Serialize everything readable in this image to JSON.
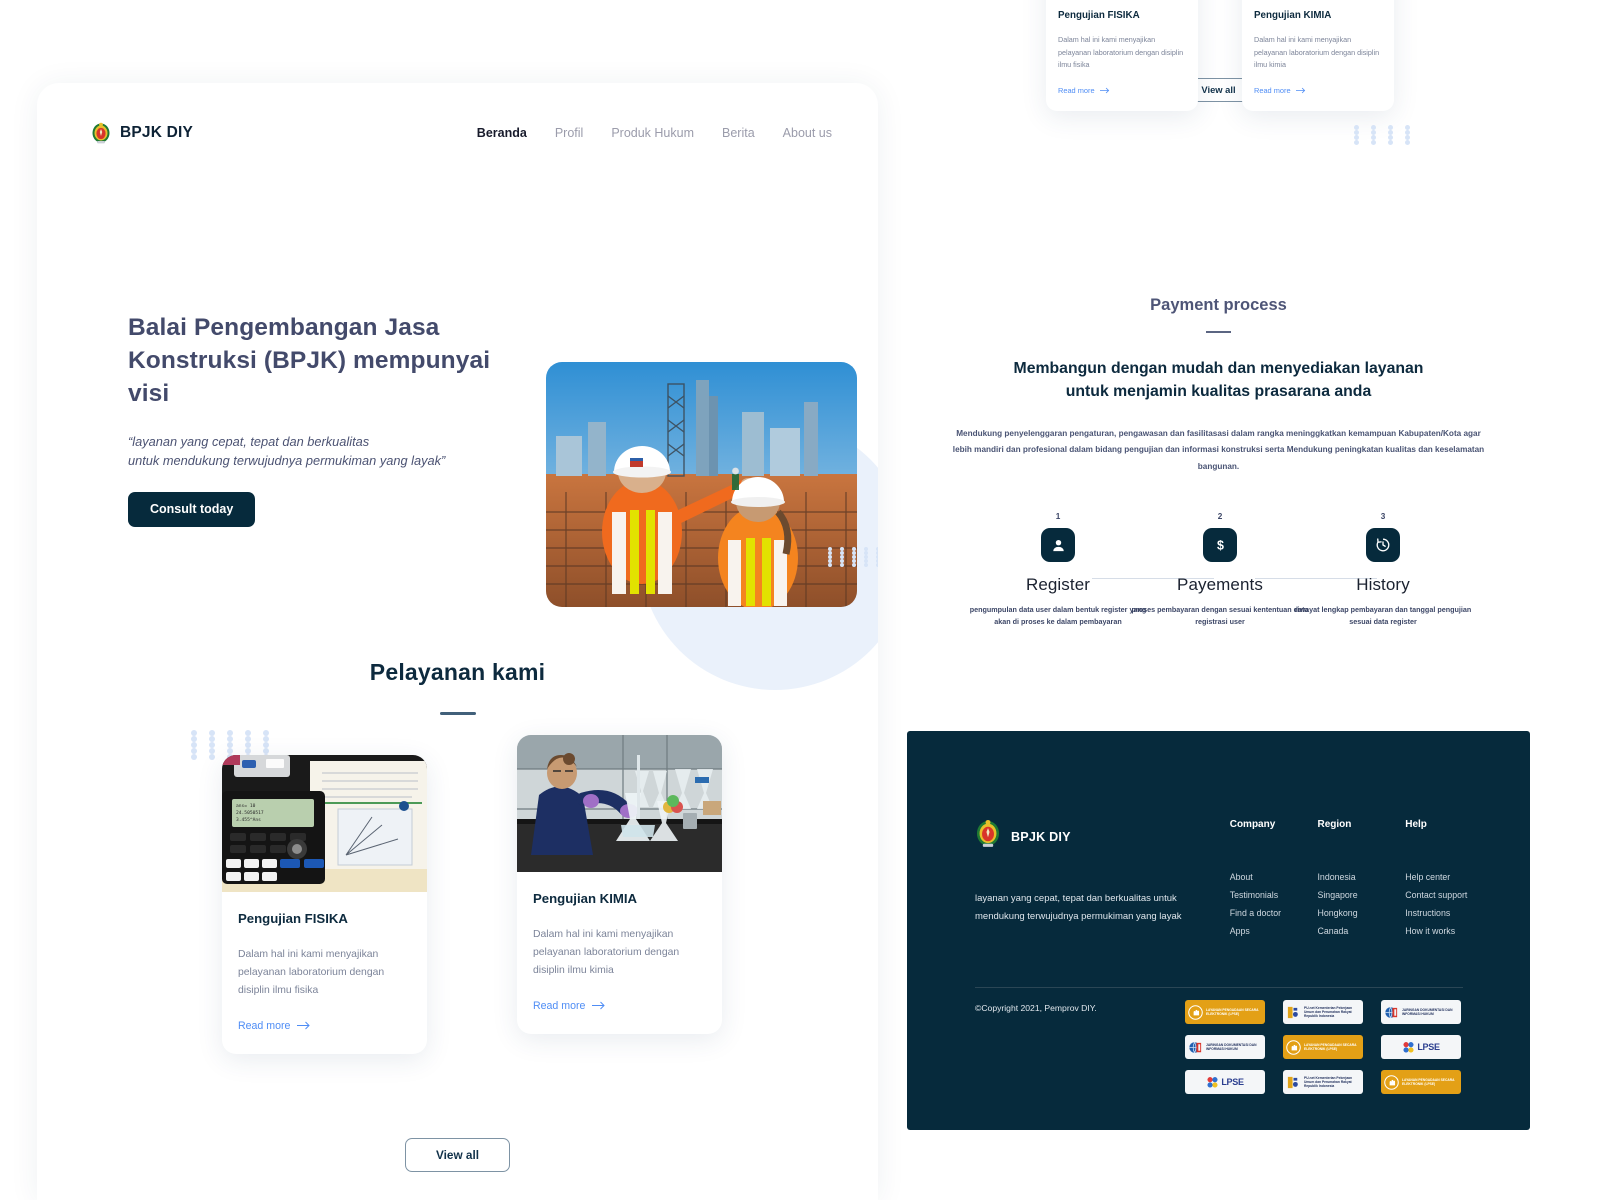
{
  "brand": {
    "name": "BPJK DIY",
    "logo_icon": "coat-of-arms-icon"
  },
  "nav": {
    "items": [
      {
        "label": "Beranda",
        "active": true
      },
      {
        "label": "Profil",
        "active": false
      },
      {
        "label": "Produk Hukum",
        "active": false
      },
      {
        "label": "Berita",
        "active": false
      },
      {
        "label": "About us",
        "active": false
      }
    ]
  },
  "hero": {
    "title": "Balai Pengembangan Jasa Konstruksi  (BPJK) mempunyai visi",
    "subtitle_line1": "“layanan yang cepat, tepat dan berkualitas",
    "subtitle_line2": "untuk mendukung terwujudnya permukiman yang layak”",
    "cta_label": "Consult today",
    "image_alt": "construction-workers-site-photo"
  },
  "services": {
    "title": "Pelayanan kami",
    "view_all_label": "View all",
    "read_more_label": "Read more",
    "cards": [
      {
        "title": "Pengujian FISIKA",
        "desc": "Dalam hal ini kami menyajikan pelayanan laboratorium dengan disiplin ilmu fisika",
        "link": "Read more",
        "image_alt": "calculator-and-notebook-photo"
      },
      {
        "title": "Pengujian KIMIA",
        "desc": "Dalam hal ini kami menyajikan pelayanan laboratorium dengan disiplin ilmu kimia",
        "link": "Read more",
        "image_alt": "chemistry-lab-technician-photo"
      }
    ]
  },
  "right_top": {
    "view_all_label": "View all",
    "cards": [
      {
        "title": "Pengujian FISIKA",
        "desc": "Dalam hal ini kami menyajikan pelayanan laboratorium dengan disiplin ilmu fisika",
        "link": "Read more"
      },
      {
        "title": "Pengujian KIMIA",
        "desc": "Dalam hal ini kami menyajikan pelayanan laboratorium dengan disiplin ilmu kimia",
        "link": "Read more"
      }
    ]
  },
  "payment": {
    "eyebrow": "Payment process",
    "heading_line1": "Membangun dengan mudah dan menyediakan layanan",
    "heading_line2": "untuk menjamin kualitas prasarana anda",
    "paragraph": "Mendukung penyelenggaran pengaturan, pengawasan dan fasilitasasi dalam rangka meninggkatkan kemampuan Kabupaten/Kota agar lebih mandiri dan profesional dalam bidang pengujian dan informasi konstruksi  serta Mendukung peningkatan kualitas dan keselamatan bangunan.",
    "steps": [
      {
        "number": "1",
        "icon": "user-icon",
        "name": "Register",
        "desc": "pengumpulan data user dalam bentuk register yang akan di proses ke dalam pembayaran"
      },
      {
        "number": "2",
        "icon": "dollar-icon",
        "name": "Payements",
        "desc": "proses pembayaran dengan sesuai kententuan data registrasi user"
      },
      {
        "number": "3",
        "icon": "history-clock-icon",
        "name": "History",
        "desc": "riwayat lengkap pembayaran dan tanggal pengujian sesuai data register"
      }
    ]
  },
  "footer": {
    "brand_name": "BPJK DIY",
    "tagline": "layanan yang cepat, tepat dan berkualitas untuk mendukung terwujudnya permukiman yang layak",
    "columns": [
      {
        "title": "Company",
        "links": [
          "About",
          "Testimonials",
          "Find a doctor",
          "Apps"
        ]
      },
      {
        "title": "Region",
        "links": [
          "Indonesia",
          "Singapore",
          "Hongkong",
          "Canada"
        ]
      },
      {
        "title": "Help",
        "links": [
          "Help center",
          "Contact support",
          "Instructions",
          "How it works"
        ]
      }
    ],
    "copyright": "©Copyright 2021, Pemprov DIY.",
    "badges": [
      {
        "kind": "orange",
        "icon": "lpse-hand-icon",
        "text": "LAYANAN PENGADAAN SECARA ELEKTRONIK (LPSE)"
      },
      {
        "kind": "white",
        "icon": "pu-net-icon",
        "text": "PU-net Kementerian Pekerjaan Umum dan Perumahan Rakyat Republik Indonesia"
      },
      {
        "kind": "white",
        "icon": "jdih-globe-icon",
        "text": "JARINGAN DOKUMENTASI DAN INFORMASI HUKUM"
      },
      {
        "kind": "white",
        "icon": "jdih-globe-icon",
        "text": "JARINGAN DOKUMENTASI DAN INFORMASI HUKUM"
      },
      {
        "kind": "orange",
        "icon": "lpse-hand-icon",
        "text": "LAYANAN PENGADAAN SECARA ELEKTRONIK (LPSE)"
      },
      {
        "kind": "white",
        "icon": "lpse-dots-icon",
        "text": "LPSE"
      },
      {
        "kind": "white",
        "icon": "lpse-dots-icon",
        "text": "LPSE"
      },
      {
        "kind": "white",
        "icon": "pu-net-icon",
        "text": "PU-net Kementerian Pekerjaan Umum dan Perumahan Rakyat Republik Indonesia"
      },
      {
        "kind": "orange",
        "icon": "lpse-hand-icon",
        "text": "LAYANAN PENGADAAN SECARA ELEKTRONIK (LPSE)"
      }
    ]
  },
  "colors": {
    "dark_navy": "#062a3c",
    "heading_purple": "#434a6b",
    "link_blue": "#4f8df5",
    "dot_blue": "#d7e4f7",
    "badge_orange": "#e3a016"
  }
}
